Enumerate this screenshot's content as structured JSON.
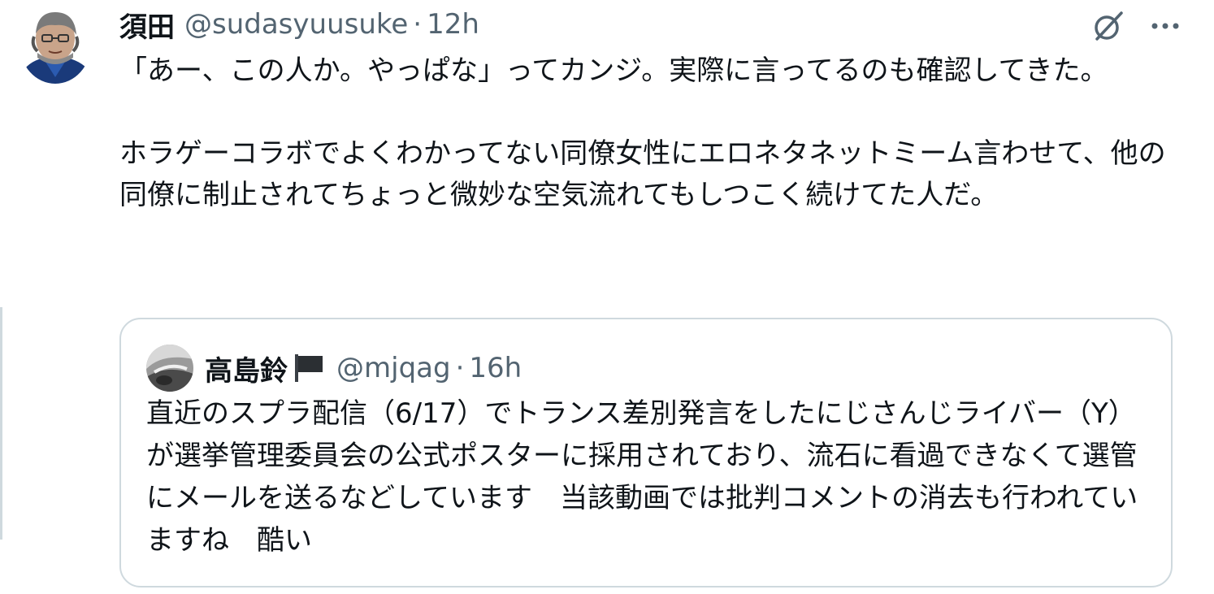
{
  "tweet": {
    "author": {
      "display_name": "須田",
      "handle": "@sudasyuusuke",
      "separator": "·",
      "time": "12h"
    },
    "icons": {
      "grok": "grok-slash-icon",
      "more": "more-horizontal-icon"
    },
    "text": "「あー、この人か。やっぱな」ってカンジ。実際に言ってるのも確認してきた。\n\nホラゲーコラボでよくわかってない同僚女性にエロネタネットミーム言わせて、他の同僚に制止されてちょっと微妙な空気流れてもしつこく続けてた人だ。"
  },
  "quote": {
    "author": {
      "display_name": "高島鈴",
      "flag_icon": "black-flag-icon",
      "handle": "@mjqag",
      "separator": "·",
      "time": "16h"
    },
    "text": "直近のスプラ配信（6/17）でトランス差別発言をしたにじさんじライバー（Y）が選挙管理委員会の公式ポスターに採用されており、流石に看過できなくて選管にメールを送るなどしています　当該動画では批判コメントの消去も行われていますね　酷い"
  },
  "colors": {
    "text_primary": "#0f1419",
    "text_secondary": "#536471",
    "border": "#cfd9de"
  }
}
